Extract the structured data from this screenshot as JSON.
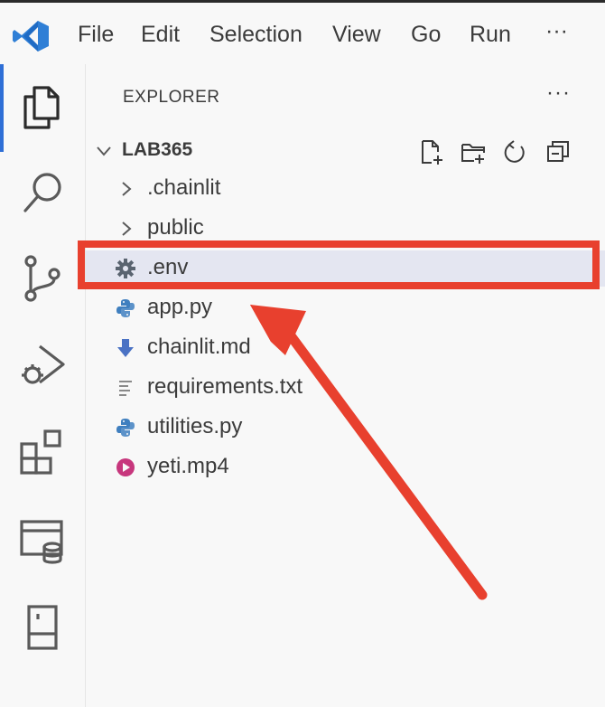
{
  "menubar": {
    "items": [
      "File",
      "Edit",
      "Selection",
      "View",
      "Go",
      "Run",
      "···"
    ]
  },
  "activitybar": {
    "icons": [
      "explorer-icon",
      "search-icon",
      "source-control-icon",
      "run-debug-icon",
      "extensions-icon",
      "remote-database-icon",
      "testing-panel-icon"
    ],
    "active": "explorer-icon"
  },
  "explorer": {
    "title": "EXPLORER",
    "more": "···",
    "root": "LAB365",
    "items": [
      {
        "label": ".chainlit",
        "kind": "folder",
        "icon": "chevron-right-icon"
      },
      {
        "label": "public",
        "kind": "folder",
        "icon": "chevron-right-icon"
      },
      {
        "label": ".env",
        "kind": "file",
        "icon": "gear-icon",
        "selected": true
      },
      {
        "label": "app.py",
        "kind": "file",
        "icon": "python-icon"
      },
      {
        "label": "chainlit.md",
        "kind": "file",
        "icon": "markdown-icon"
      },
      {
        "label": "requirements.txt",
        "kind": "file",
        "icon": "text-file-icon"
      },
      {
        "label": "utilities.py",
        "kind": "file",
        "icon": "python-icon"
      },
      {
        "label": "yeti.mp4",
        "kind": "file",
        "icon": "video-icon"
      }
    ]
  },
  "colors": {
    "accent": "#2f6fd6",
    "annotation": "#e8402e",
    "python": "#3f7fbf",
    "markdown": "#4a72c4",
    "video": "#c7377d",
    "text": "#3b3b3b"
  }
}
